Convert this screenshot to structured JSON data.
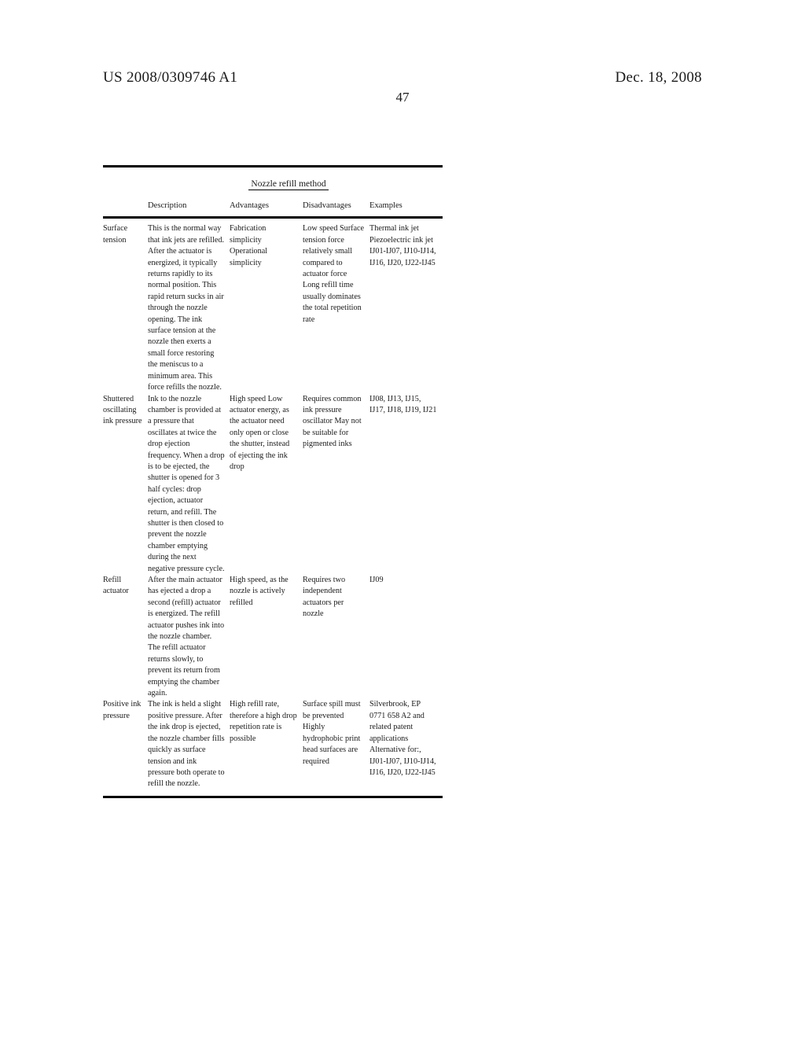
{
  "header": {
    "publication_number": "US 2008/0309746 A1",
    "publication_date": "Dec. 18, 2008",
    "page_number": "47"
  },
  "table": {
    "title": "Nozzle refill method",
    "columns": {
      "label": "",
      "description": "Description",
      "advantages": "Advantages",
      "disadvantages": "Disadvantages",
      "examples": "Examples"
    },
    "rows": [
      {
        "label": "Surface tension",
        "description": "This is the normal way that ink jets are refilled. After the actuator is energized, it typically returns rapidly to its normal position. This rapid return sucks in air through the nozzle opening. The ink surface tension at the nozzle then exerts a small force restoring the meniscus to a minimum area. This force refills the nozzle.",
        "advantages": "Fabrication simplicity Operational simplicity",
        "disadvantages": "Low speed Surface tension force relatively small compared to actuator force Long refill time usually dominates the total repetition rate",
        "examples": "Thermal ink jet Piezoelectric ink jet IJ01-IJ07, IJ10-IJ14, IJ16, IJ20, IJ22-IJ45"
      },
      {
        "label": "Shuttered oscillating ink pressure",
        "description": "Ink to the nozzle chamber is provided at a pressure that oscillates at twice the drop ejection frequency. When a drop is to be ejected, the shutter is opened for 3 half cycles: drop ejection, actuator return, and refill. The shutter is then closed to prevent the nozzle chamber emptying during the next negative pressure cycle.",
        "advantages": "High speed Low actuator energy, as the actuator need only open or close the shutter, instead of ejecting the ink drop",
        "disadvantages": "Requires common ink pressure oscillator May not be suitable for pigmented inks",
        "examples": "IJ08, IJ13, IJ15, IJ17, IJ18, IJ19, IJ21"
      },
      {
        "label": "Refill actuator",
        "description": "After the main actuator has ejected a drop a second (refill) actuator is energized. The refill actuator pushes ink into the nozzle chamber. The refill actuator returns slowly, to prevent its return from emptying the chamber again.",
        "advantages": "High speed, as the nozzle is actively refilled",
        "disadvantages": "Requires two independent actuators per nozzle",
        "examples": "IJ09"
      },
      {
        "label": "Positive ink pressure",
        "description": "The ink is held a slight positive pressure. After the ink drop is ejected, the nozzle chamber fills quickly as surface tension and ink pressure both operate to refill the nozzle.",
        "advantages": "High refill rate, therefore a high drop repetition rate is possible",
        "disadvantages": "Surface spill must be prevented Highly hydrophobic print head surfaces are required",
        "examples": "Silverbrook, EP 0771 658 A2 and related patent applications Alternative for:, IJ01-IJ07, IJ10-IJ14, IJ16, IJ20, IJ22-IJ45"
      }
    ]
  }
}
